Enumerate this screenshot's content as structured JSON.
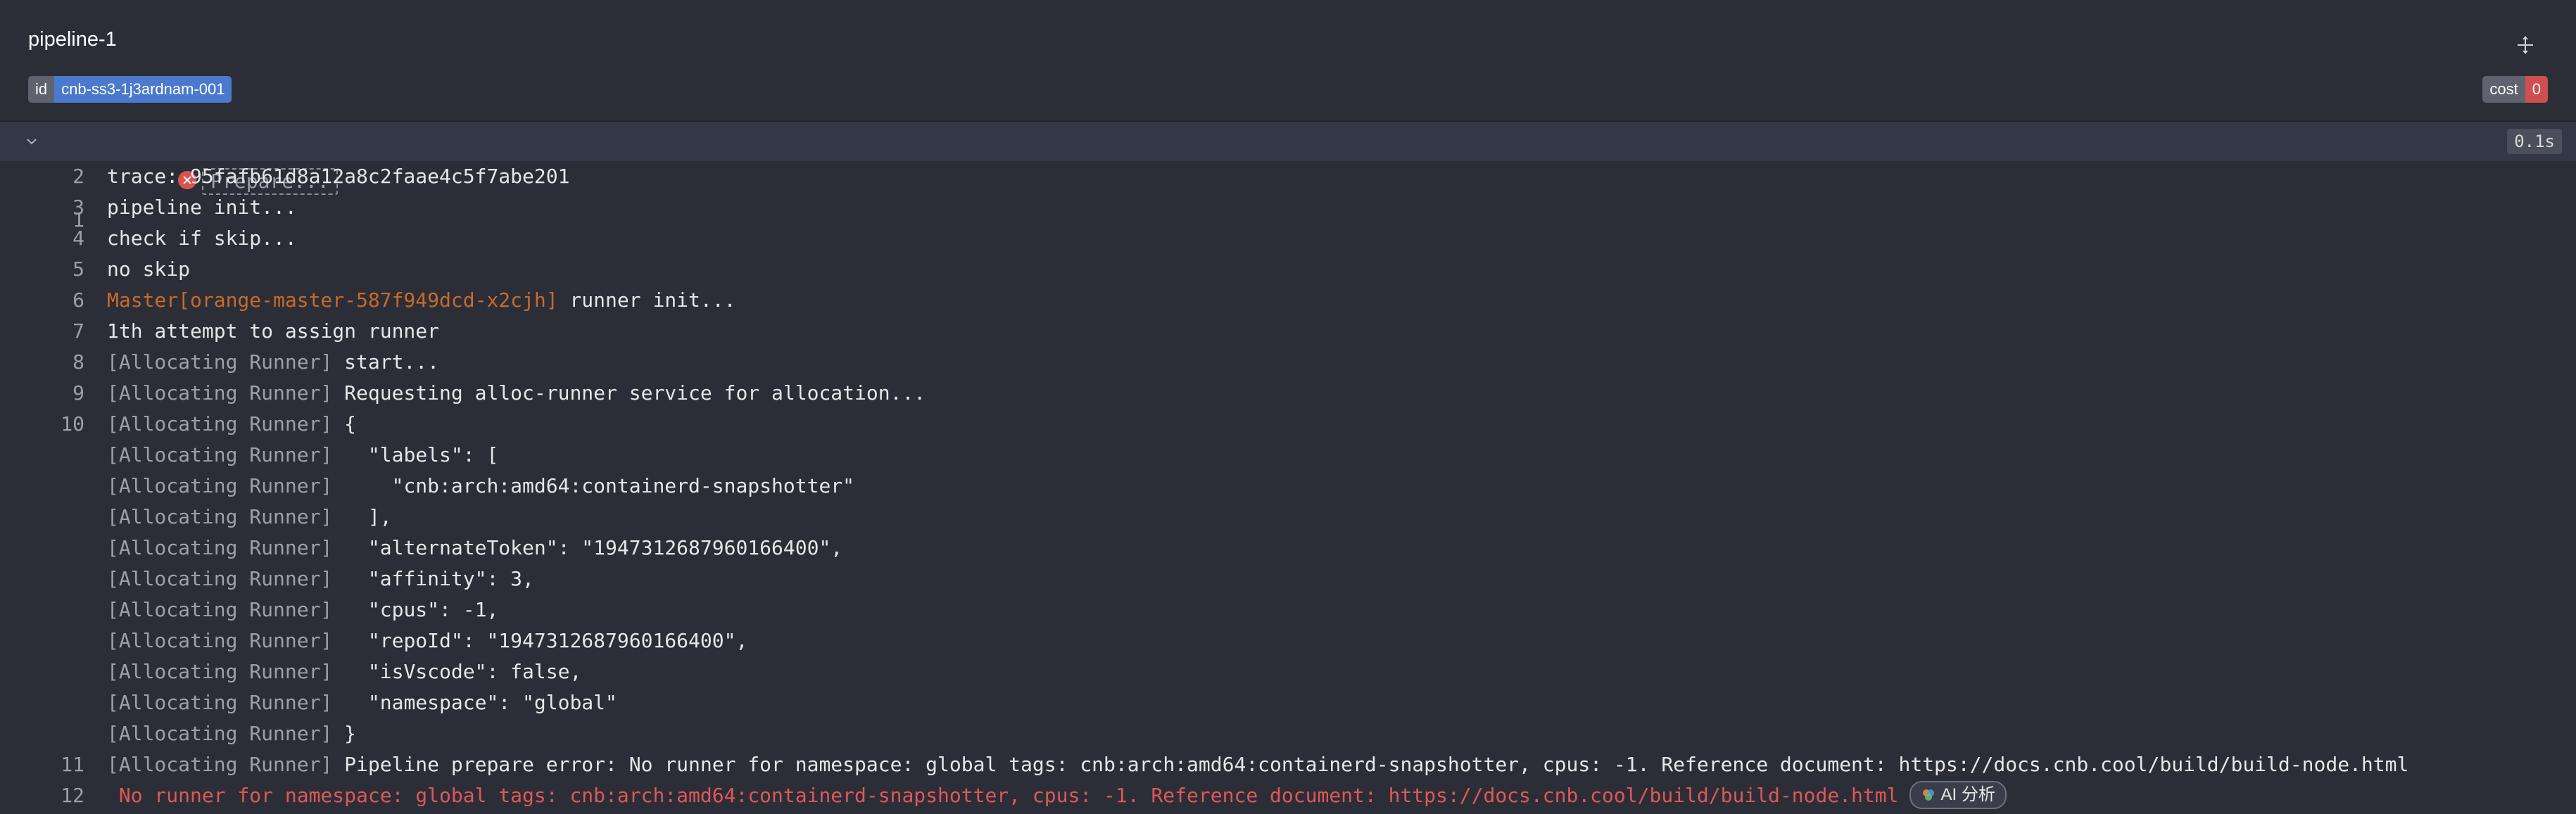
{
  "header": {
    "title": "pipeline-1",
    "id_key": "id",
    "id_value": "cnb-ss3-1j3ardnam-001",
    "cost_key": "cost",
    "cost_value": "0"
  },
  "log": {
    "stage_label": "Prepare...",
    "duration": "0.1s",
    "lines": [
      {
        "n": "1",
        "tag": "",
        "text": ""
      },
      {
        "n": "2",
        "tag": "",
        "text": "trace: 95fafb61d8a12a8c2faae4c5f7abe201"
      },
      {
        "n": "3",
        "tag": "",
        "text": "pipeline init..."
      },
      {
        "n": "4",
        "tag": "",
        "text": "check if skip..."
      },
      {
        "n": "5",
        "tag": "",
        "text": "no skip"
      },
      {
        "n": "6",
        "tag": "Master[orange-master-587f949dcd-x2cjh]",
        "text": " runner init..."
      },
      {
        "n": "7",
        "tag": "",
        "text": "1th attempt to assign runner"
      },
      {
        "n": "8",
        "tag": "[Allocating Runner]",
        "text": " start..."
      },
      {
        "n": "9",
        "tag": "[Allocating Runner]",
        "text": " Requesting alloc-runner service for allocation..."
      },
      {
        "n": "10",
        "tag": "[Allocating Runner]",
        "text": " {"
      },
      {
        "n": "",
        "tag": "[Allocating Runner]",
        "text": "   \"labels\": ["
      },
      {
        "n": "",
        "tag": "[Allocating Runner]",
        "text": "     \"cnb:arch:amd64:containerd-snapshotter\""
      },
      {
        "n": "",
        "tag": "[Allocating Runner]",
        "text": "   ],"
      },
      {
        "n": "",
        "tag": "[Allocating Runner]",
        "text": "   \"alternateToken\": \"1947312687960166400\","
      },
      {
        "n": "",
        "tag": "[Allocating Runner]",
        "text": "   \"affinity\": 3,"
      },
      {
        "n": "",
        "tag": "[Allocating Runner]",
        "text": "   \"cpus\": -1,"
      },
      {
        "n": "",
        "tag": "[Allocating Runner]",
        "text": "   \"repoId\": \"1947312687960166400\","
      },
      {
        "n": "",
        "tag": "[Allocating Runner]",
        "text": "   \"isVscode\": false,"
      },
      {
        "n": "",
        "tag": "[Allocating Runner]",
        "text": "   \"namespace\": \"global\""
      },
      {
        "n": "",
        "tag": "[Allocating Runner]",
        "text": " }"
      },
      {
        "n": "11",
        "tag": "[Allocating Runner]",
        "text": " Pipeline prepare error: No runner for namespace: global tags: cnb:arch:amd64:containerd-snapshotter, cpus: -1. Reference document: https://docs.cnb.cool/build/build-node.html"
      },
      {
        "n": "12",
        "tag": "",
        "text": " No runner for namespace: global tags: cnb:arch:amd64:containerd-snapshotter, cpus: -1. Reference document: https://docs.cnb.cool/build/build-node.html"
      }
    ]
  },
  "ai_button": "AI 分析"
}
